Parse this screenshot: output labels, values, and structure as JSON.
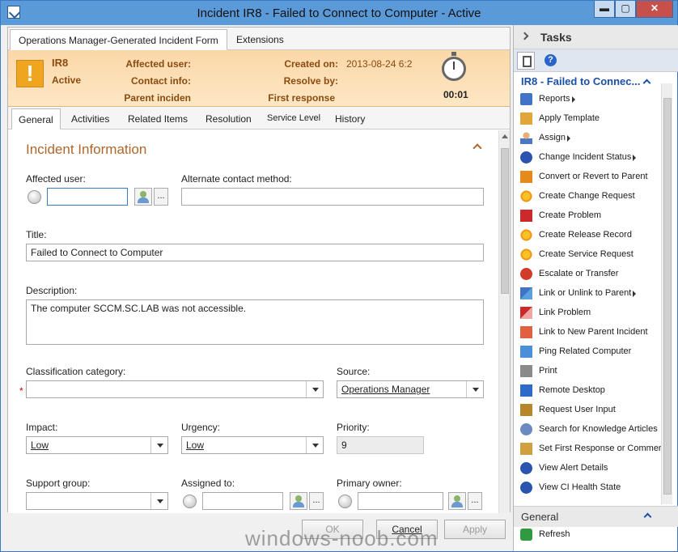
{
  "window": {
    "title": "Incident IR8 - Failed to Connect to Computer - Active",
    "min_label": "▬",
    "max_label": "▢",
    "close_label": "✕"
  },
  "form_tabs": [
    "Operations Manager-Generated Incident Form",
    "Extensions"
  ],
  "header": {
    "id": "IR8",
    "status": "Active",
    "affected_user_label": "Affected user:",
    "contact_info_label": "Contact info:",
    "parent_incident_label": "Parent inciden",
    "created_on_label": "Created on:",
    "created_on_value": "2013-08-24 6:2",
    "resolve_by_label": "Resolve by:",
    "first_response_label": "First response",
    "timer": "00:01",
    "warning_glyph": "!"
  },
  "sub_tabs": [
    "General",
    "Activities",
    "Related Items",
    "Resolution",
    "Service Level",
    "History"
  ],
  "section": {
    "title": "Incident Information"
  },
  "fields": {
    "affected_user_label": "Affected user:",
    "affected_user_value": "",
    "alternate_contact_label": "Alternate contact method:",
    "alternate_contact_value": "",
    "title_label": "Title:",
    "title_value": "Failed to Connect to Computer",
    "description_label": "Description:",
    "description_value": "The computer SCCM.SC.LAB was not accessible.",
    "classification_label": "Classification category:",
    "classification_value": "",
    "source_label": "Source:",
    "source_value": "Operations Manager",
    "impact_label": "Impact:",
    "impact_value": "Low",
    "urgency_label": "Urgency:",
    "urgency_value": "Low",
    "priority_label": "Priority:",
    "priority_value": "9",
    "support_group_label": "Support group:",
    "support_group_value": "",
    "assigned_to_label": "Assigned to:",
    "assigned_to_value": "",
    "primary_owner_label": "Primary owner:",
    "primary_owner_value": "",
    "ellipsis": "...",
    "required_mark": "*"
  },
  "buttons": {
    "ok": "OK",
    "cancel": "Cancel",
    "apply": "Apply"
  },
  "watermark": "windows-noob.com",
  "tasks": {
    "header": "Tasks",
    "help_glyph": "?",
    "title": "IR8 - Failed to Connec...",
    "items": [
      {
        "label": "Reports",
        "icon": "report-icon",
        "submenu": true
      },
      {
        "label": "Apply Template",
        "icon": "template-icon",
        "submenu": false
      },
      {
        "label": "Assign",
        "icon": "person-icon",
        "submenu": true
      },
      {
        "label": "Change Incident Status",
        "icon": "info-icon",
        "submenu": true
      },
      {
        "label": "Convert or Revert to Parent",
        "icon": "warning-icon",
        "submenu": false
      },
      {
        "label": "Create Change Request",
        "icon": "star-icon",
        "submenu": false
      },
      {
        "label": "Create Problem",
        "icon": "problem-icon",
        "submenu": false
      },
      {
        "label": "Create Release Record",
        "icon": "star-icon",
        "submenu": false
      },
      {
        "label": "Create Service Request",
        "icon": "star-icon",
        "submenu": false
      },
      {
        "label": "Escalate or Transfer",
        "icon": "escalate-icon",
        "submenu": false
      },
      {
        "label": "Link or Unlink to Parent",
        "icon": "link-icon",
        "submenu": true
      },
      {
        "label": "Link Problem",
        "icon": "link-problem-icon",
        "submenu": false
      },
      {
        "label": "Link to New Parent Incident",
        "icon": "link-parent-icon",
        "submenu": false
      },
      {
        "label": "Ping Related Computer",
        "icon": "ping-icon",
        "submenu": false
      },
      {
        "label": "Print",
        "icon": "print-icon",
        "submenu": false
      },
      {
        "label": "Remote Desktop",
        "icon": "remote-desktop-icon",
        "submenu": false
      },
      {
        "label": "Request User Input",
        "icon": "request-icon",
        "submenu": false
      },
      {
        "label": "Search for Knowledge Articles",
        "icon": "search-icon",
        "submenu": false
      },
      {
        "label": "Set First Response or Commer",
        "icon": "first-response-icon",
        "submenu": false
      },
      {
        "label": "View Alert Details",
        "icon": "alert-icon",
        "submenu": false
      },
      {
        "label": "View CI Health State",
        "icon": "health-icon",
        "submenu": false
      }
    ],
    "general_header": "General",
    "refresh": "Refresh"
  }
}
